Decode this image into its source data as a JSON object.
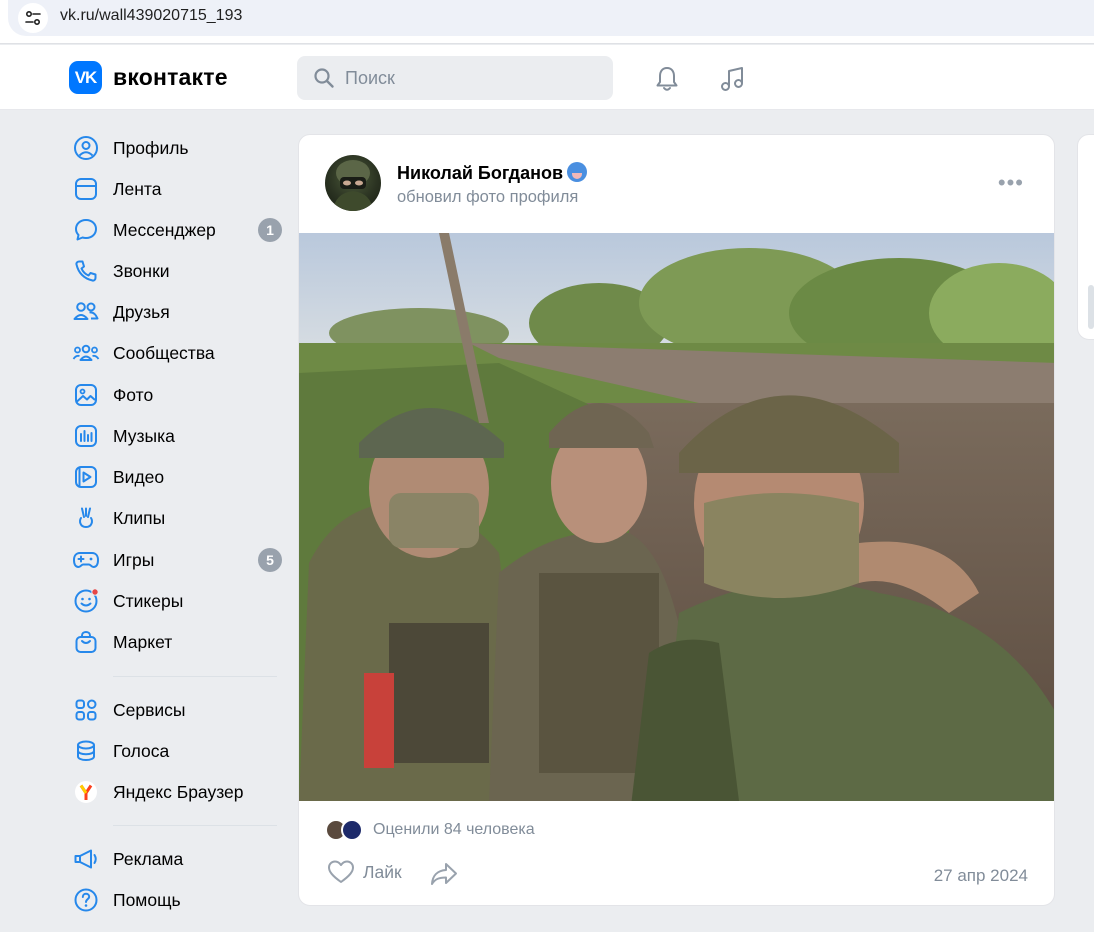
{
  "browser": {
    "url": "vk.ru/wall439020715_193",
    "site_info_icon": "tune-icon"
  },
  "header": {
    "logo_text": "вконтакте",
    "logo_mark": "VK",
    "search_placeholder": "Поиск",
    "icons": [
      "bell-icon",
      "music-note-icon"
    ],
    "accent_color": "#0077ff"
  },
  "sidebar": {
    "items": [
      {
        "label": "Профиль",
        "icon": "user-circle-icon"
      },
      {
        "label": "Лента",
        "icon": "feed-icon"
      },
      {
        "label": "Мессенджер",
        "icon": "chat-bubble-icon",
        "badge": "1"
      },
      {
        "label": "Звонки",
        "icon": "phone-icon"
      },
      {
        "label": "Друзья",
        "icon": "friends-icon"
      },
      {
        "label": "Сообщества",
        "icon": "communities-icon"
      },
      {
        "label": "Фото",
        "icon": "photo-icon"
      },
      {
        "label": "Музыка",
        "icon": "music-icon"
      },
      {
        "label": "Видео",
        "icon": "video-icon"
      },
      {
        "label": "Клипы",
        "icon": "clips-icon"
      },
      {
        "label": "Игры",
        "icon": "gamepad-icon",
        "badge": "5"
      },
      {
        "label": "Стикеры",
        "icon": "smile-icon"
      },
      {
        "label": "Маркет",
        "icon": "shopping-bag-icon"
      }
    ],
    "items2": [
      {
        "label": "Сервисы",
        "icon": "services-grid-icon"
      },
      {
        "label": "Голоса",
        "icon": "coins-icon"
      },
      {
        "label": "Яндекс Браузер",
        "icon": "yandex-browser-icon"
      }
    ],
    "items3": [
      {
        "label": "Реклама",
        "icon": "megaphone-icon"
      },
      {
        "label": "Помощь",
        "icon": "help-circle-icon"
      }
    ],
    "badge_color": "#99a2ad"
  },
  "post": {
    "author": "Николай Богданов",
    "author_emoji": "blue-face-emoji",
    "action": "обновил фото профиля",
    "more_icon": "more-horizontal-icon",
    "photo": "three soldiers in camouflage and helmets taking a selfie on a dirt road",
    "likers_text": "Оценили 84 человека",
    "like_label": "Лайк",
    "date": "27 апр 2024"
  }
}
